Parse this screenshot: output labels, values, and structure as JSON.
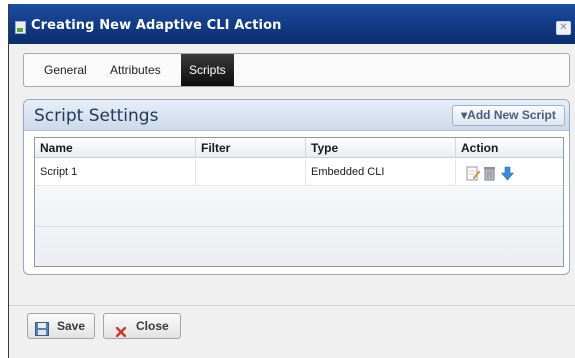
{
  "dialog": {
    "title": "Creating New Adaptive CLI Action",
    "close_glyph": "✕"
  },
  "tabs": [
    {
      "label": "General",
      "active": false
    },
    {
      "label": "Attributes",
      "active": false
    },
    {
      "label": "Scripts",
      "active": true
    }
  ],
  "script_settings": {
    "title": "Script Settings",
    "add_button_label": "▾Add New Script",
    "columns": [
      "Name",
      "Filter",
      "Type",
      "Action"
    ],
    "rows": [
      {
        "name": "Script 1",
        "filter": "",
        "type": "Embedded CLI",
        "action_icons": [
          "edit-icon",
          "delete-icon",
          "move-down-icon"
        ]
      }
    ]
  },
  "footer": {
    "save_label": "Save",
    "close_label": "Close"
  },
  "colors": {
    "titlebar": "#123a84",
    "active_tab": "#1a1a1a",
    "panel_header": "#cdd9ea",
    "accent_blue": "#3f8ad6",
    "close_red": "#c0392b"
  }
}
